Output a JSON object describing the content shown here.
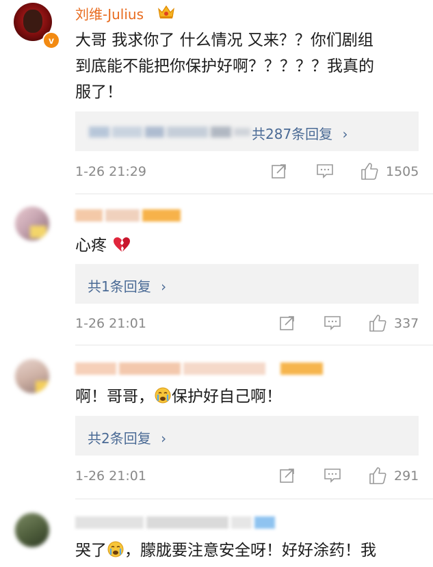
{
  "comments": [
    {
      "user": "刘维-Julius",
      "text": "大哥 我求你了 什么情况 又来？？你们剧组到底能不能把你保护好啊？？？？？我真的服了！",
      "text_lines": [
        "大哥 我求你了 什么情况 又来？？你们剧组",
        "到底能不能把你保护好啊？？？？？我真的",
        "服了！"
      ],
      "reply_text": "共287条回复",
      "time": "1-26 21:29",
      "likes": "1505"
    },
    {
      "user": "",
      "text": "心疼",
      "reply_text": "共1条回复",
      "time": "1-26 21:01",
      "likes": "337"
    },
    {
      "user": "",
      "text": "啊！哥哥，保护好自己啊！",
      "text_a": "啊！哥哥，",
      "text_b": "保护好自己啊！",
      "reply_text": "共2条回复",
      "time": "1-26 21:01",
      "likes": "291"
    },
    {
      "user": "",
      "text": "哭了，朦胧要注意安全呀！好好涂药！我",
      "text_a": "哭了",
      "text_b": "，朦胧要注意安全呀！好好涂药！我"
    }
  ],
  "icons": {
    "crown": "crown-icon",
    "verified": "verified-v-icon",
    "share": "share-icon",
    "comment": "comment-icon",
    "like": "thumbs-up-icon",
    "chevron": "chevron-right-icon",
    "broken_heart": "broken-heart-emoji",
    "crying": "crying-face-emoji"
  },
  "colors": {
    "username": "#e86b1e",
    "link": "#4a6a95",
    "meta": "#888888",
    "reply_bg": "#f2f2f2"
  }
}
